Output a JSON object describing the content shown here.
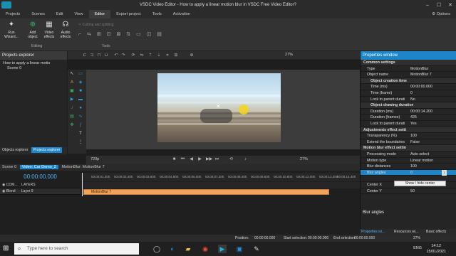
{
  "window": {
    "title": "VSDC Video Editor - How to apply a linear motion blur in VSDC Free Video Editor?"
  },
  "menu": [
    {
      "label": "Projects"
    },
    {
      "label": "Scenes"
    },
    {
      "label": "Edit"
    },
    {
      "label": "View"
    },
    {
      "label": "Editor"
    },
    {
      "label": "Export project"
    },
    {
      "label": "Tools"
    },
    {
      "label": "Activation"
    }
  ],
  "menu_options": "Options",
  "ribbon": {
    "run_wizard": "Run\nWizard...",
    "add_object": "Add\nobject",
    "video_effects": "Video\neffects",
    "audio_effects": "Audio\neffects",
    "cutting": "Cutting and splitting",
    "editing_group": "Editing",
    "tools_group": "Tools"
  },
  "toolbar2": {
    "zoom": "27%"
  },
  "project_explorer": {
    "title": "Projects explorer",
    "items": [
      "How to apply a linear motio",
      "Scene 0"
    ],
    "tabs": [
      "Objects explorer",
      "Projects explorer"
    ]
  },
  "playbar": {
    "zoom": "720p",
    "zoom2": "27%"
  },
  "scene_tabs": [
    "Scene 0",
    "Video: Car Demo_2",
    "MotionBlur: MotionBlur 7"
  ],
  "timeline": {
    "timecode": "00:00:00.000",
    "ruler": [
      "00:00:01.200",
      "00:00:02.400",
      "00:00:03.600",
      "00:00:04.800",
      "00:00:06.000",
      "00:00:07.200",
      "00:00:08.400",
      "00:00:09.600",
      "00:00:10.800",
      "00:00:12.000",
      "00:00:13.200",
      "00:00:14.400"
    ],
    "tracks": [
      {
        "col1": "COM...",
        "col2": "LAYERS"
      },
      {
        "col1": "Blend",
        "col2": "Layer 9"
      }
    ],
    "clip_label": "MotionBlur 7"
  },
  "status": {
    "position": "Position:",
    "position_val": "00:00:00.000",
    "start_sel": "Start selection:",
    "start_val": "00:00:00.000",
    "end_sel": "End selection:",
    "end_val": "00:00:00.000",
    "zoom": "27%"
  },
  "properties": {
    "title": "Properties window",
    "rows": [
      {
        "type": "sec",
        "k": "Common settings",
        "v": ""
      },
      {
        "type": "row",
        "k": "Type",
        "v": "MotionBlur"
      },
      {
        "type": "row",
        "k": "Object name",
        "v": "MotionBlur 7"
      },
      {
        "type": "sec2",
        "k": "Object creation time",
        "v": ""
      },
      {
        "type": "sub",
        "k": "Time (ms)",
        "v": "00:00:00.000"
      },
      {
        "type": "sub",
        "k": "Time (frame)",
        "v": "0"
      },
      {
        "type": "sub",
        "k": "Lock to parent durati",
        "v": "No"
      },
      {
        "type": "sec2",
        "k": "Object drawing duration",
        "v": ""
      },
      {
        "type": "sub",
        "k": "Duration (ms)",
        "v": "00:00:14.200"
      },
      {
        "type": "sub",
        "k": "Duration (frames)",
        "v": "426"
      },
      {
        "type": "sub",
        "k": "Lock to parent durati",
        "v": "Yes"
      },
      {
        "type": "sec",
        "k": "Adjustments effect settings",
        "v": ""
      },
      {
        "type": "row",
        "k": "Transparency (%)",
        "v": "100"
      },
      {
        "type": "row",
        "k": "Extend the boundaries",
        "v": "False"
      },
      {
        "type": "sec",
        "k": "Motion blur effect settings",
        "v": ""
      },
      {
        "type": "row",
        "k": "Processing mode",
        "v": "Auto select"
      },
      {
        "type": "row",
        "k": "Motion type",
        "v": "Linear motion"
      },
      {
        "type": "row",
        "k": "Blur distances",
        "v": "100"
      },
      {
        "type": "sel",
        "k": "Blur angles",
        "v": "0"
      },
      {
        "type": "gap",
        "k": "",
        "v": ""
      },
      {
        "type": "row",
        "k": "Center X",
        "v": "50"
      },
      {
        "type": "row",
        "k": "Center Y",
        "v": "50"
      }
    ],
    "tooltip": "Show / hide center",
    "description": "Blur angles",
    "tabs": [
      "Properties wi...",
      "Resources wi...",
      "Basic effects"
    ]
  },
  "taskbar": {
    "search_placeholder": "Type here to search",
    "tray_lang": "ENG",
    "time": "14:12",
    "date": "15/01/2021"
  }
}
